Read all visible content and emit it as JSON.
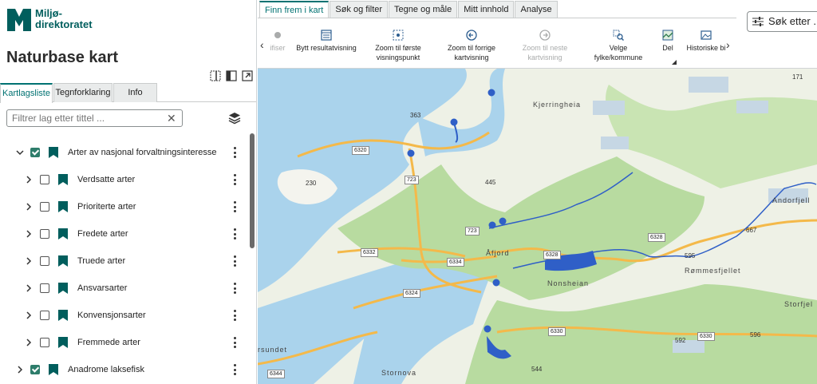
{
  "brand": {
    "name_line1": "Miljø-",
    "name_line2": "direktoratet",
    "color": "#005e5d"
  },
  "app_title": "Naturbase kart",
  "left_tabs": [
    "Kartlagsliste",
    "Tegnforklaring",
    "Info"
  ],
  "filter": {
    "placeholder": "Filtrer lag etter tittel ..."
  },
  "layers": [
    {
      "label": "Arter av nasjonal forvaltningsinteresse",
      "checked": true,
      "expanded": true,
      "level": 0
    },
    {
      "label": "Verdsatte arter",
      "checked": false,
      "expanded": false,
      "level": 1
    },
    {
      "label": "Prioriterte arter",
      "checked": false,
      "expanded": false,
      "level": 1
    },
    {
      "label": "Fredete arter",
      "checked": false,
      "expanded": false,
      "level": 1
    },
    {
      "label": "Truede arter",
      "checked": false,
      "expanded": false,
      "level": 1
    },
    {
      "label": "Ansvarsarter",
      "checked": false,
      "expanded": false,
      "level": 1
    },
    {
      "label": "Konvensjonsarter",
      "checked": false,
      "expanded": false,
      "level": 1
    },
    {
      "label": "Fremmede arter",
      "checked": false,
      "expanded": false,
      "level": 1
    },
    {
      "label": "Anadrome laksefisk",
      "checked": true,
      "expanded": false,
      "level": 0
    }
  ],
  "top_tabs": [
    "Finn frem i kart",
    "Søk og filter",
    "Tegne og måle",
    "Mitt innhold",
    "Analyse"
  ],
  "search": {
    "label": "Søk etter ..."
  },
  "tools": [
    {
      "label": "ifiser",
      "dim": true
    },
    {
      "label": "Bytt resultatvisning",
      "dim": false
    },
    {
      "label": "Zoom til første visningspunkt",
      "dim": false
    },
    {
      "label": "Zoom til forrige kartvisning",
      "dim": false
    },
    {
      "label": "Zoom til neste kartvisning",
      "dim": true
    },
    {
      "label": "Velge fylke/kommune",
      "dim": false
    },
    {
      "label": "Del",
      "dim": false
    },
    {
      "label": "Historiske bi",
      "dim": false
    }
  ],
  "map": {
    "places": [
      "Kjerringheia",
      "Åfjord",
      "Nonsheian",
      "Rømmesfjellet",
      "Storfjel",
      "Andorfjell",
      "Stornova",
      "rsundet"
    ],
    "heights": [
      "363",
      "445",
      "230",
      "595",
      "667",
      "592",
      "544",
      "596",
      "171"
    ],
    "roads": [
      "6320",
      "723",
      "723",
      "6332",
      "6334",
      "6324",
      "6328",
      "6328",
      "6330",
      "6330",
      "6344"
    ],
    "colors": {
      "water": "#aad3ec",
      "forest": "#b8dba0",
      "land": "#eef1e6",
      "road": "#f4b94a",
      "layer": "#2f5fc7"
    }
  }
}
